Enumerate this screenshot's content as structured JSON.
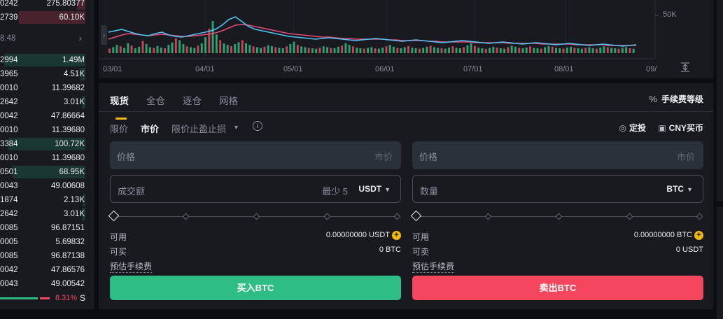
{
  "orderbook": {
    "asks": [
      {
        "price": "0242",
        "qty": "275.80377",
        "depth": 0.1
      },
      {
        "price": "2739",
        "qty": "60.10K",
        "depth": 0.78
      }
    ],
    "mid_price": "8.48",
    "bids": [
      {
        "price": "2994",
        "qty": "1.49M",
        "depth": 0.95
      },
      {
        "price": "3965",
        "qty": "4.51K",
        "depth": 0.06
      },
      {
        "price": "0010",
        "qty": "11.39682",
        "depth": 0.0
      },
      {
        "price": "2642",
        "qty": "3.01K",
        "depth": 0.04
      },
      {
        "price": "0042",
        "qty": "47.86664",
        "depth": 0.0
      },
      {
        "price": "0010",
        "qty": "11.39680",
        "depth": 0.0
      },
      {
        "price": "3384",
        "qty": "100.72K",
        "depth": 0.9
      },
      {
        "price": "0010",
        "qty": "11.39680",
        "depth": 0.0
      },
      {
        "price": "0501",
        "qty": "68.95K",
        "depth": 0.85
      },
      {
        "price": "0043",
        "qty": "49.00608",
        "depth": 0.0
      },
      {
        "price": "1874",
        "qty": "2.13K",
        "depth": 0.03
      },
      {
        "price": "2642",
        "qty": "3.01K",
        "depth": 0.04
      },
      {
        "price": "0085",
        "qty": "96.87151",
        "depth": 0.0
      },
      {
        "price": "0005",
        "qty": "5.69832",
        "depth": 0.0
      },
      {
        "price": "0085",
        "qty": "96.87138",
        "depth": 0.0
      },
      {
        "price": "0042",
        "qty": "47.86576",
        "depth": 0.0
      },
      {
        "price": "0043",
        "qty": "49.00542",
        "depth": 0.0
      }
    ],
    "sell_ratio": "8.31%",
    "sell_ratio_label": "S",
    "colors": {
      "bid": "#2ebd85",
      "ask": "#f6465d"
    }
  },
  "chart_data": {
    "type": "bar",
    "x_ticks": [
      "03/01",
      "04/01",
      "05/01",
      "06/01",
      "07/01",
      "08/01",
      "09/"
    ],
    "y_ticks": [
      "50K"
    ],
    "volume_bars": [
      8,
      12,
      18,
      14,
      10,
      22,
      16,
      9,
      13,
      28,
      20,
      12,
      10,
      15,
      11,
      9,
      18,
      24,
      35,
      30,
      20,
      14,
      12,
      10,
      16,
      22,
      38,
      60,
      80,
      45,
      30,
      22,
      18,
      15,
      20,
      25,
      30,
      22,
      18,
      14,
      12,
      10,
      13,
      17,
      15,
      12,
      10,
      9,
      14,
      20,
      26,
      18,
      14,
      12,
      10,
      9,
      8,
      11,
      14,
      12,
      10,
      9,
      13,
      16,
      22,
      18,
      14,
      11,
      9,
      8,
      10,
      12,
      9,
      8,
      11,
      14,
      18,
      13,
      10,
      9,
      12,
      15,
      11,
      9,
      8,
      10,
      13,
      16,
      12,
      10,
      9,
      8,
      11,
      14,
      10,
      9,
      12,
      17,
      22,
      15,
      11,
      9,
      8,
      10,
      13,
      11,
      9,
      8,
      12,
      16,
      13,
      10,
      9,
      11,
      14,
      10,
      9,
      8,
      12,
      15,
      13,
      10,
      9,
      8,
      11,
      13,
      10,
      9,
      8,
      10,
      12,
      9,
      8,
      11,
      14,
      12,
      10,
      9,
      8,
      10,
      12,
      9,
      8
    ],
    "ma_line_1": [
      40,
      42,
      44,
      41,
      38,
      36,
      35,
      38,
      40,
      36,
      34,
      33,
      35,
      37,
      39,
      41,
      44,
      50,
      58,
      62,
      55,
      48,
      44,
      42,
      40,
      38,
      36,
      34,
      33,
      32,
      31,
      30,
      31,
      32,
      31,
      30,
      29,
      28,
      29,
      30,
      31,
      30,
      29,
      28,
      27,
      28,
      29,
      28,
      27,
      26,
      25,
      26,
      27,
      28,
      27,
      26,
      25,
      24,
      25,
      26,
      25,
      24,
      23,
      24,
      25,
      24,
      23,
      22,
      23,
      24,
      23,
      22,
      21,
      22,
      23,
      22,
      21,
      20,
      21,
      22
    ],
    "ma_line_2": [
      30,
      33,
      36,
      38,
      37,
      36,
      35,
      36,
      37,
      36,
      35,
      34,
      34,
      35,
      36,
      37,
      39,
      42,
      46,
      50,
      51,
      50,
      48,
      46,
      44,
      42,
      40,
      38,
      37,
      36,
      35,
      34,
      33,
      33,
      32,
      31,
      31,
      30,
      30,
      30,
      30,
      30,
      29,
      29,
      28,
      28,
      28,
      28,
      27,
      27,
      26,
      26,
      26,
      26,
      26,
      25,
      25,
      25,
      25,
      25,
      24,
      24,
      24,
      24,
      24,
      23,
      23,
      23,
      23,
      23,
      22,
      22,
      22,
      22,
      22,
      21,
      21,
      21,
      21,
      21
    ],
    "colors": {
      "up": "#2ebd85",
      "down": "#f6465d",
      "ma1": "#4fc3f7",
      "ma2": "#e84a75"
    }
  },
  "trade": {
    "tabs": [
      "现货",
      "全仓",
      "逐仓",
      "网格"
    ],
    "active_tab": "现货",
    "fee_level_label": "手续费等级",
    "order_types": [
      "限价",
      "市价",
      "限价止盈止损"
    ],
    "active_order_type": "市价",
    "dca_label": "定投",
    "buy_cny_label": "CNY买币",
    "buy": {
      "price_label": "价格",
      "price_placeholder": "市价",
      "amount_label": "成交额",
      "min_label": "最少 5",
      "amount_unit": "USDT",
      "available_label": "可用",
      "available_value": "0.00000000 USDT",
      "max_label": "可买",
      "max_value": "0 BTC",
      "fee_label": "预估手续费",
      "button": "买入BTC"
    },
    "sell": {
      "price_label": "价格",
      "price_placeholder": "市价",
      "amount_label": "数量",
      "amount_unit": "BTC",
      "available_label": "可用",
      "available_value": "0.00000000 BTC",
      "max_label": "可卖",
      "max_value": "0 USDT",
      "fee_label": "预估手续费",
      "button": "卖出BTC"
    }
  },
  "icons": {
    "fee": "percent-icon",
    "info": "info-icon",
    "dca": "recurring-icon",
    "wallet": "wallet-icon",
    "plus": "plus-circle-icon",
    "reset": "reset-scale-icon"
  }
}
